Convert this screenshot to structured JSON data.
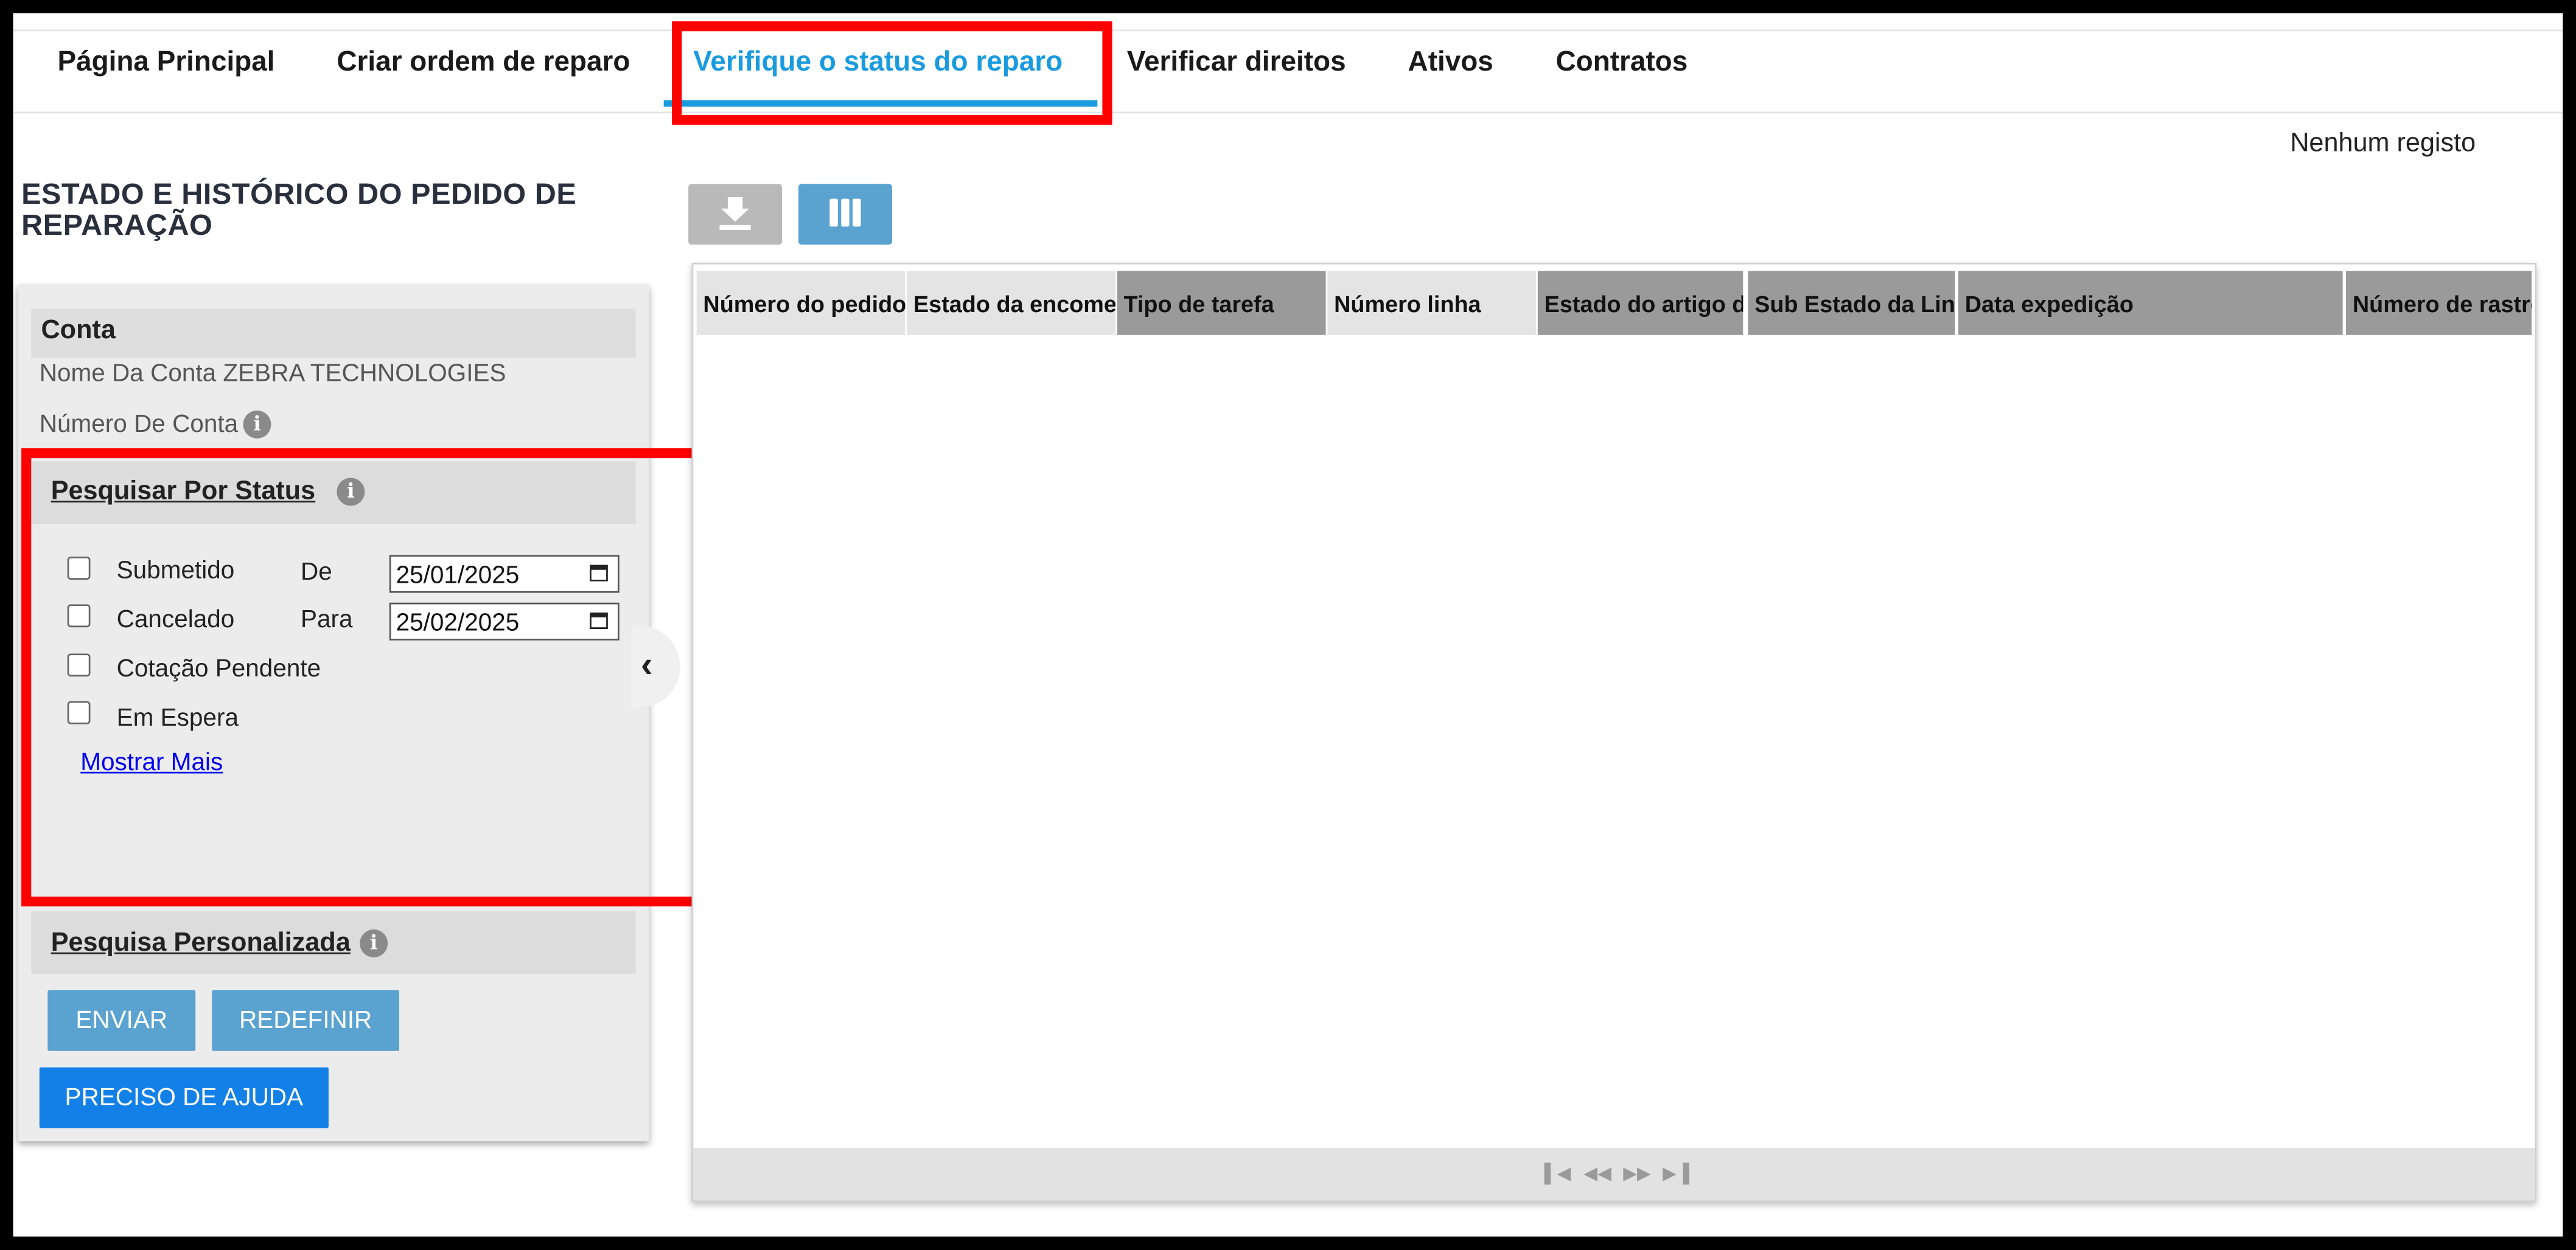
{
  "nav": {
    "tabs": [
      {
        "label": "Página Principal"
      },
      {
        "label": "Criar ordem de reparo"
      },
      {
        "label": "Verifique o status do reparo"
      },
      {
        "label": "Verificar direitos"
      },
      {
        "label": "Ativos"
      },
      {
        "label": "Contratos"
      }
    ],
    "active_tab": 2
  },
  "page": {
    "title": "ESTADO E HISTÓRICO DO PEDIDO DE REPARAÇÃO",
    "no_records": "Nenhum registo"
  },
  "account": {
    "header": "Conta",
    "name_label": "Nome Da Conta",
    "name_value": "ZEBRA TECHNOLOGIES",
    "number_label": "Número De Conta",
    "number_value": ""
  },
  "status_search": {
    "header": "Pesquisar Por Status",
    "options": [
      {
        "label": "Submetido",
        "checked": false
      },
      {
        "label": "Cancelado",
        "checked": false
      },
      {
        "label": "Cotação Pendente",
        "checked": false
      },
      {
        "label": "Em Espera",
        "checked": false
      }
    ],
    "from_label": "De",
    "from_value": "25/01/2025",
    "to_label": "Para",
    "to_value": "25/02/2025",
    "show_more": "Mostrar Mais"
  },
  "custom_search": {
    "header": "Pesquisa Personalizada"
  },
  "buttons": {
    "submit": "ENVIAR",
    "reset": "REDEFINIR",
    "help": "PRECISO DE AJUDA"
  },
  "toolbar": {
    "download_icon": "download-icon",
    "columns_icon": "columns-icon",
    "download_color": "#b9b9b9",
    "columns_color": "#5aa2d0"
  },
  "grid": {
    "columns": [
      "Número do pedido",
      "Estado da encomenda",
      "Tipo de tarefa",
      "Número linha",
      "Estado do artigo de",
      "Sub Estado da Linha",
      "Data expedição",
      "Número de rastreio"
    ],
    "rows": []
  },
  "colors": {
    "accent": "#1a9be0",
    "highlight": "#ff0000",
    "primary_button": "#1280e6"
  }
}
